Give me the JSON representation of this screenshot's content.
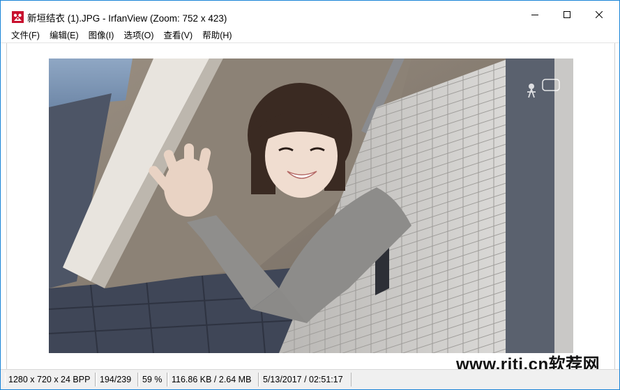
{
  "window": {
    "title": "新垣结衣 (1).JPG - IrfanView (Zoom: 752 x 423)",
    "controls": {
      "minimize": "minimize",
      "maximize": "maximize",
      "close": "close"
    },
    "accent_color": "#1883d7"
  },
  "menu": {
    "items": [
      {
        "label": "文件(F)",
        "key": "file"
      },
      {
        "label": "编辑(E)",
        "key": "edit"
      },
      {
        "label": "图像(I)",
        "key": "image"
      },
      {
        "label": "选项(O)",
        "key": "options"
      },
      {
        "label": "查看(V)",
        "key": "view"
      },
      {
        "label": "帮助(H)",
        "key": "help"
      }
    ]
  },
  "viewer": {
    "image_description_icon": "photo-image"
  },
  "watermark": {
    "text": "www.rjtj.cn软荐网"
  },
  "status": {
    "dimensions": "1280 x 720 x 24 BPP",
    "file_index": "194/239",
    "zoom": "59 %",
    "file_size": "116.86 KB / 2.64 MB",
    "timestamp": "5/13/2017 / 02:51:17"
  }
}
